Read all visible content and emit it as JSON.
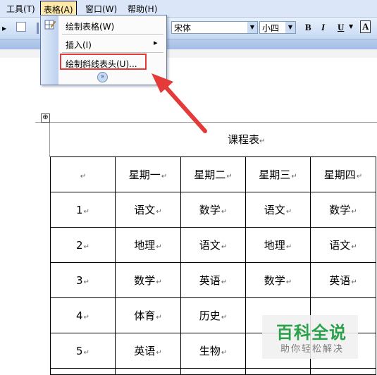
{
  "menubar": {
    "items": [
      {
        "label": "工具(T)"
      },
      {
        "label": "表格(A)"
      },
      {
        "label": "窗口(W)"
      },
      {
        "label": "帮助(H)"
      }
    ]
  },
  "toolbar": {
    "font_name": "宋体",
    "font_size": "小四",
    "bold": "B",
    "italic": "I",
    "underline": "U",
    "font_color": "A"
  },
  "table_menu": {
    "items": [
      {
        "label": "绘制表格(W)"
      },
      {
        "label": "插入(I)"
      },
      {
        "label": "绘制斜线表头(U)..."
      }
    ],
    "submenu_arrow": "▸",
    "expand_glyph": "»"
  },
  "document": {
    "title": "课程表",
    "para_mark": "↵",
    "table_handle": "⊕",
    "table": {
      "header": [
        "",
        "星期一",
        "星期二",
        "星期三",
        "星期四"
      ],
      "rows": [
        [
          "1",
          "语文",
          "数学",
          "语文",
          "数学"
        ],
        [
          "2",
          "地理",
          "语文",
          "地理",
          "语文"
        ],
        [
          "3",
          "数学",
          "英语",
          "数学",
          "英语"
        ],
        [
          "4",
          "体育",
          "历史",
          "",
          ""
        ],
        [
          "5",
          "英语",
          "生物",
          "",
          ""
        ],
        [
          "",
          "",
          "",
          "",
          ""
        ]
      ]
    }
  },
  "watermark": {
    "title": "百科全说",
    "subtitle": "助你轻松解决"
  },
  "colors": {
    "highlight": "#e53a3a",
    "menu_active": "#ffe9a8",
    "watermark_green": "#2aa14a"
  }
}
